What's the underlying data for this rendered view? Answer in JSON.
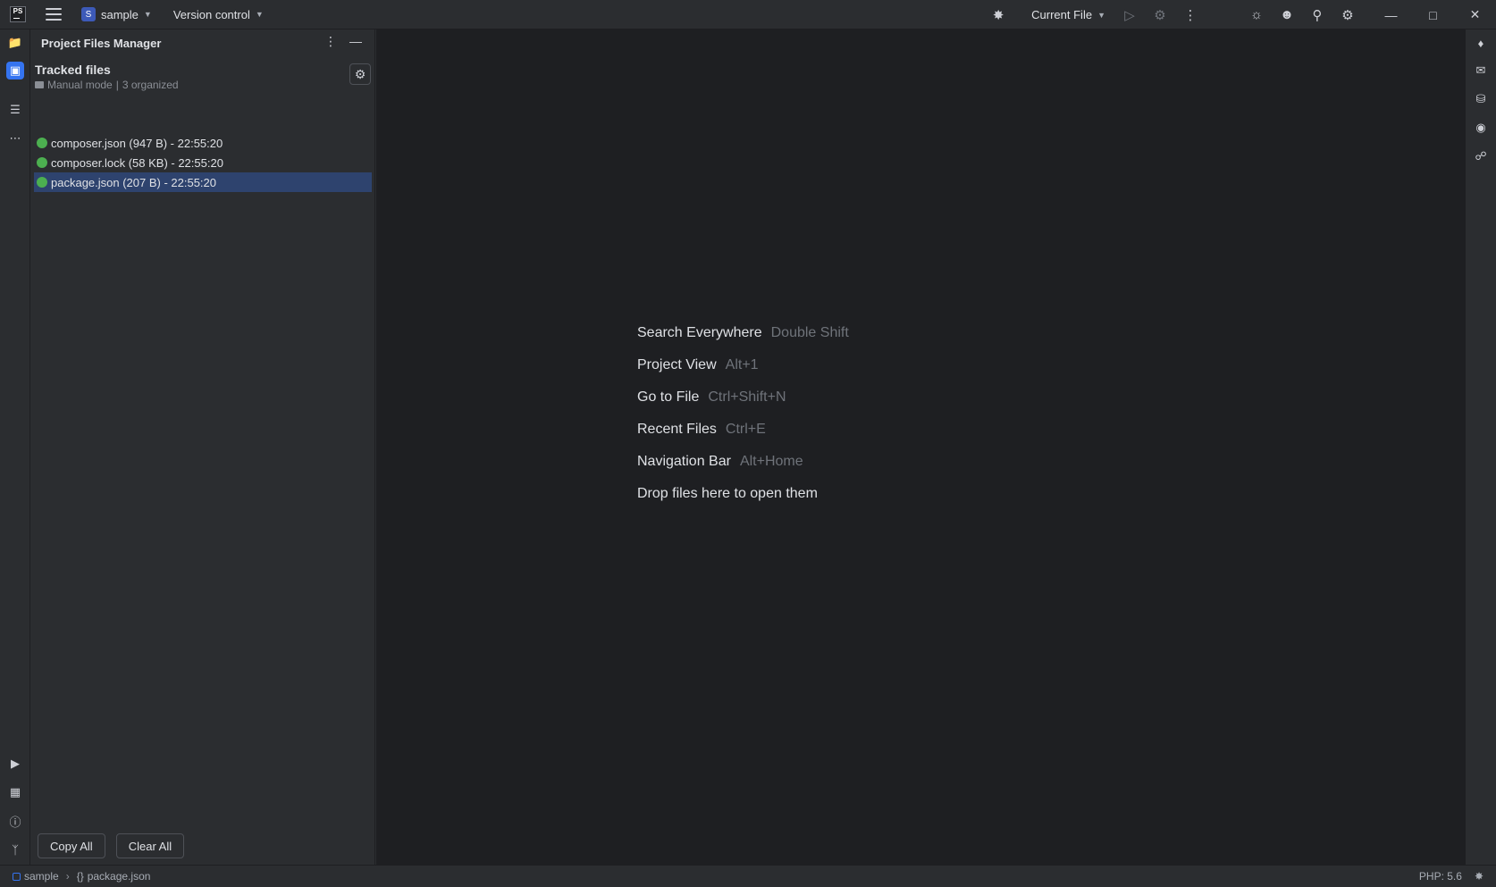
{
  "titlebar": {
    "logo_text": "PS",
    "project_badge": "S",
    "project_name": "sample",
    "vcs_label": "Version control",
    "run_config": "Current File"
  },
  "panel": {
    "title": "Project Files Manager",
    "tracked_title": "Tracked files",
    "mode": "Manual mode",
    "separator": "|",
    "organized": "3 organized",
    "files": [
      {
        "label": "composer.json (947 B) - 22:55:20",
        "status_color": "#4caf50",
        "selected": false
      },
      {
        "label": "composer.lock (58 KB) - 22:55:20",
        "status_color": "#4caf50",
        "selected": false
      },
      {
        "label": "package.json (207 B) - 22:55:20",
        "status_color": "#4caf50",
        "selected": true
      }
    ],
    "copy_all": "Copy All",
    "clear_all": "Clear All"
  },
  "editor": {
    "hints": [
      {
        "action": "Search Everywhere",
        "shortcut": "Double Shift"
      },
      {
        "action": "Project View",
        "shortcut": "Alt+1"
      },
      {
        "action": "Go to File",
        "shortcut": "Ctrl+Shift+N"
      },
      {
        "action": "Recent Files",
        "shortcut": "Ctrl+E"
      },
      {
        "action": "Navigation Bar",
        "shortcut": "Alt+Home"
      },
      {
        "action": "Drop files here to open them",
        "shortcut": ""
      }
    ]
  },
  "statusbar": {
    "project": "sample",
    "file": "package.json",
    "php_version": "PHP: 5.6"
  },
  "colors": {
    "accent": "#3574f0",
    "selection": "#2e436e",
    "status_green": "#4caf50"
  }
}
